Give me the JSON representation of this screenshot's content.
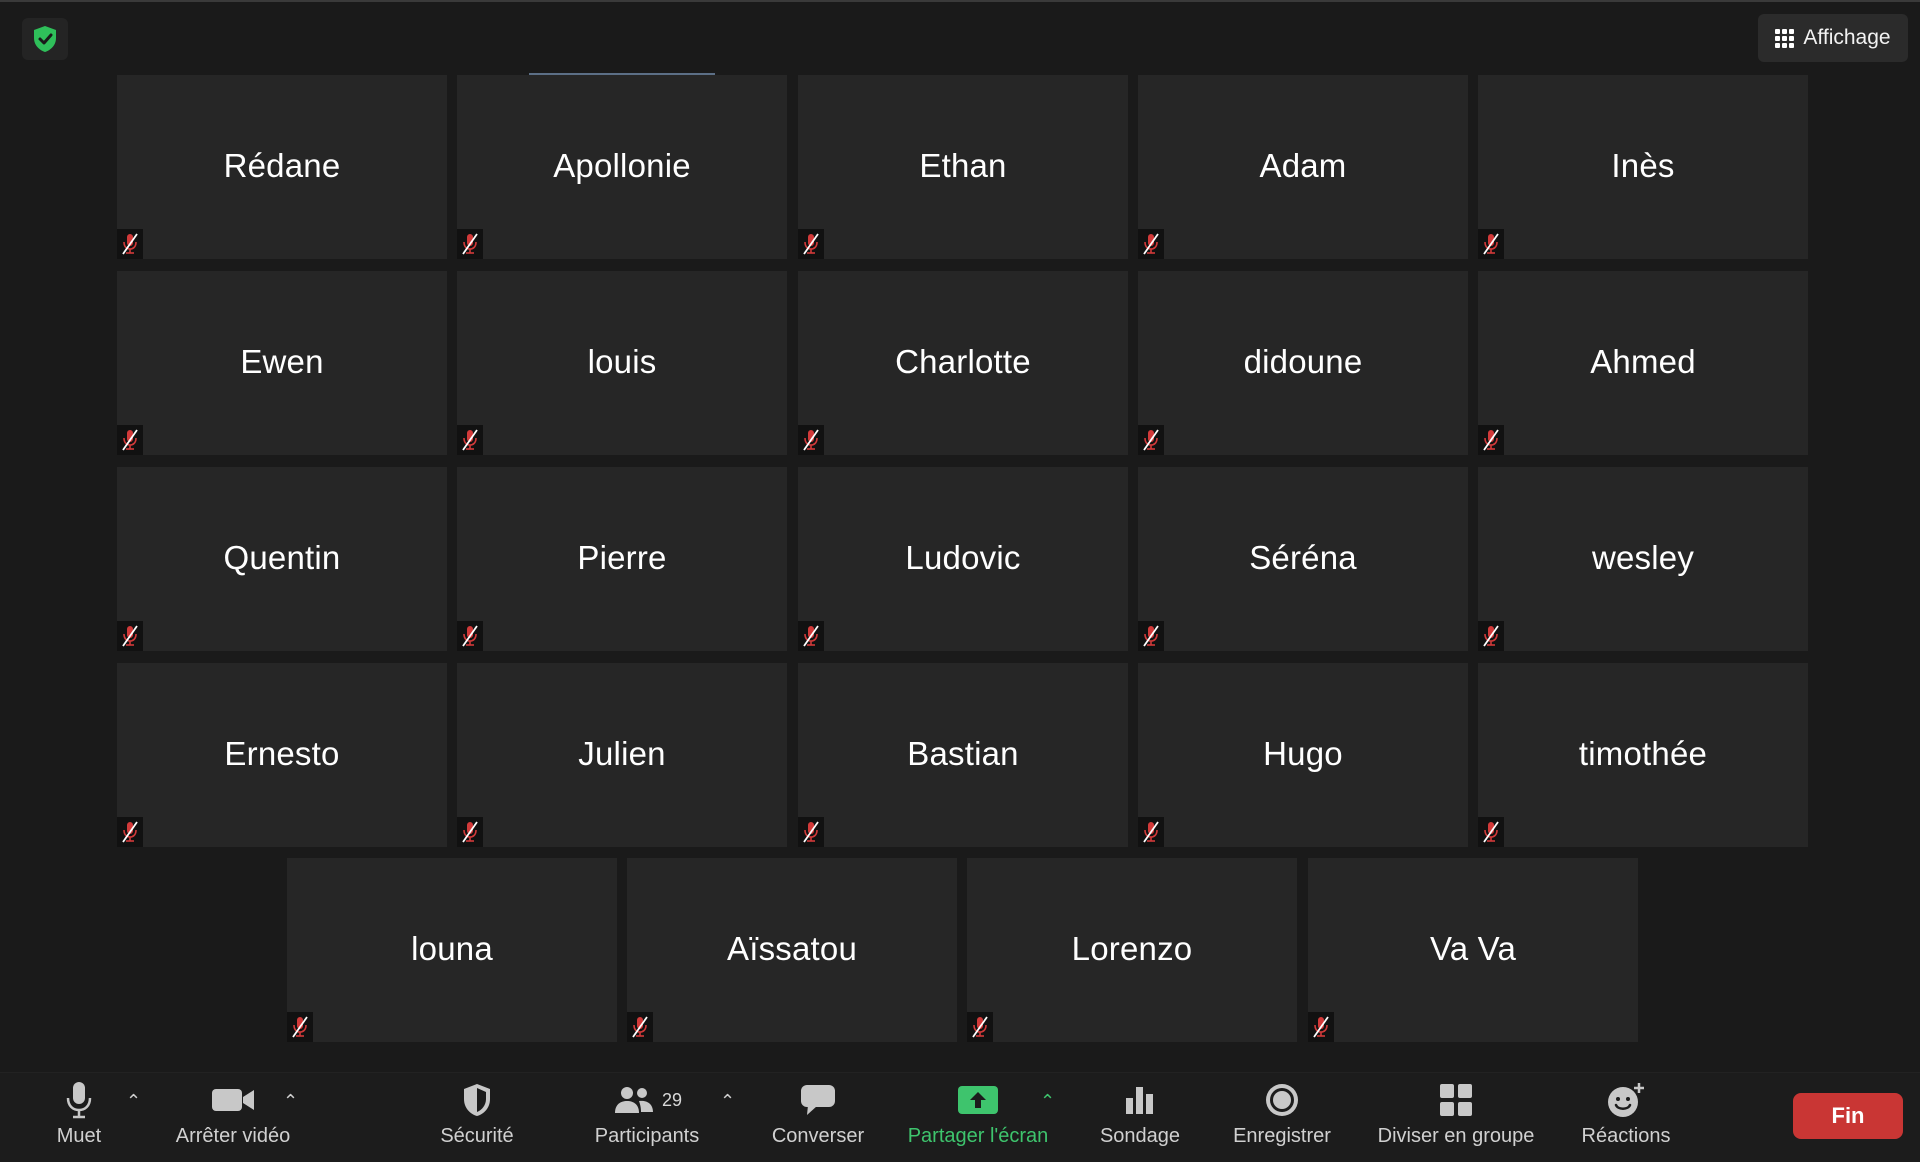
{
  "top": {
    "view_label": "Affichage"
  },
  "participants": [
    "Rédane",
    "Apollonie",
    "Ethan",
    "Adam",
    "Inès",
    "Ewen",
    "louis",
    "Charlotte",
    "didoune",
    "Ahmed",
    "Quentin",
    "Pierre",
    "Ludovic",
    "Séréna",
    "wesley",
    "Ernesto",
    "Julien",
    "Bastian",
    "Hugo",
    "timothée",
    "louna",
    "Aïssatou",
    "Lorenzo",
    "Va Va"
  ],
  "toolbar": {
    "mute": "Muet",
    "video": "Arrêter vidéo",
    "security": "Sécurité",
    "participants": "Participants",
    "participants_count": "29",
    "chat": "Converser",
    "share": "Partager l'écran",
    "poll": "Sondage",
    "record": "Enregistrer",
    "breakout": "Diviser en groupe",
    "reactions": "Réactions",
    "end": "Fin"
  },
  "colors": {
    "share_green": "#3ec46d",
    "end_red": "#c93634",
    "mute_red": "#d23a3a",
    "shield_green": "#2fbf5a"
  }
}
